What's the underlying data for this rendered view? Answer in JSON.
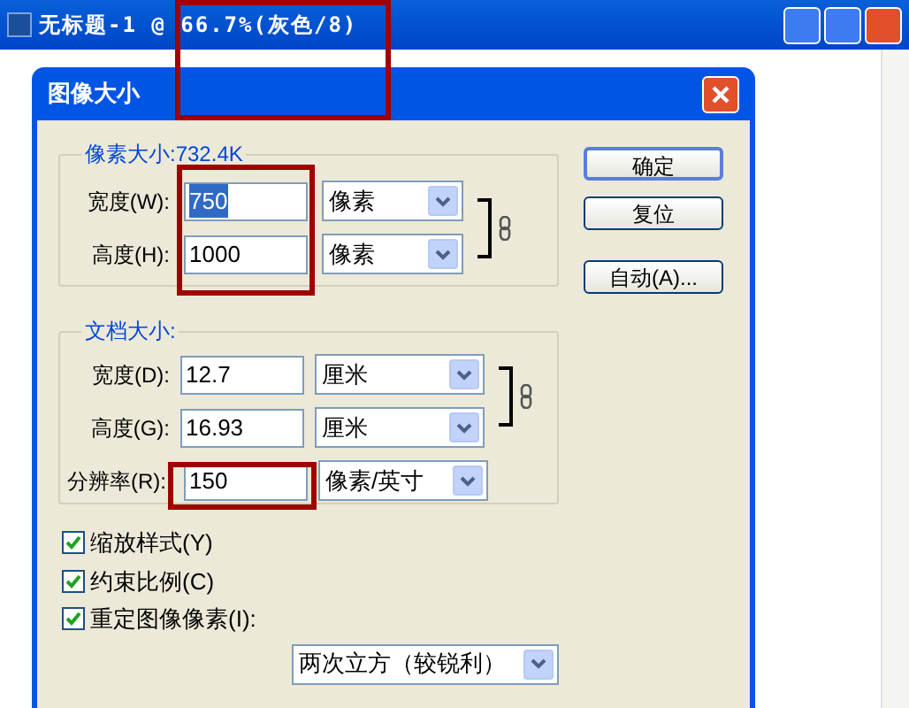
{
  "app_window": {
    "title": "无标题-1 @ 66.7%(灰色/8)"
  },
  "dialog": {
    "title": "图像大小",
    "pixel_group": {
      "title": "像素大小:732.4K",
      "rows": [
        {
          "label": "宽度(W):",
          "value": "750",
          "text_selected": true,
          "unit": "像素"
        },
        {
          "label": "高度(H):",
          "value": "1000",
          "text_selected": false,
          "unit": "像素"
        }
      ],
      "linked": true
    },
    "document_group": {
      "title": "文档大小:",
      "rows": [
        {
          "label": "宽度(D):",
          "value": "12.7",
          "unit": "厘米"
        },
        {
          "label": "高度(G):",
          "value": "16.93",
          "unit": "厘米"
        },
        {
          "label": "分辨率(R):",
          "value": "150",
          "unit": "像素/英寸"
        }
      ],
      "linked": true
    },
    "buttons": [
      {
        "label": "确定",
        "default": true
      },
      {
        "label": "复位",
        "default": false
      },
      {
        "label": "自动(A)...",
        "default": false
      }
    ],
    "checkboxes": [
      {
        "label": "缩放样式(Y)",
        "checked": true
      },
      {
        "label": "约束比例(C)",
        "checked": true
      },
      {
        "label": "重定图像像素(I):",
        "checked": true
      }
    ],
    "resample": {
      "value": "两次立方（较锐利）"
    }
  }
}
